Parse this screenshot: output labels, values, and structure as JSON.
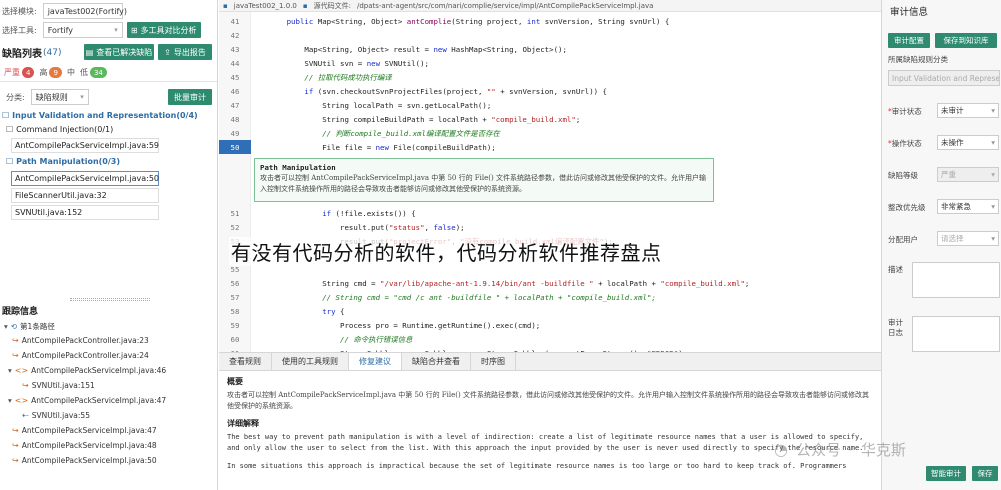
{
  "left": {
    "module_label": "选择模块:",
    "module_value": "javaTest002(Fortify)",
    "tool_label": "选择工具:",
    "tool_value": "Fortify",
    "compare_btn": "多工具对比分析",
    "defects_title": "缺陷列表",
    "defects_count": "(47)",
    "resolved_btn": "查看已解决缺陷",
    "export_btn": "导出报告",
    "sev_critical": "严重",
    "sev_critical_n": "4",
    "sev_high": "高",
    "sev_high_n": "9",
    "sev_mid": "中",
    "sev_low": "低",
    "sev_low_n": "34",
    "classify_label": "分类:",
    "classify_value": "缺陷规则",
    "batch_btn": "批量审计",
    "group1_title": "Input Validation and Representation(0/4)",
    "group1_sub": "Command Injection(0/1)",
    "group1_file": "AntCompilePackServiceImpl.java:59",
    "group2_sub": "Path Manipulation(0/3)",
    "group2_files": [
      "AntCompilePackServiceImpl.java:50",
      "FileScannerUtil.java:32",
      "SVNUtil.java:152"
    ],
    "trace_title": "跟踪信息",
    "trace_root": "第1条路径",
    "trace_items": [
      "AntCompilePackController.java:23",
      "AntCompilePackController.java:24",
      "AntCompilePackServiceImpl.java:46",
      "SVNUtil.java:151",
      "AntCompilePackServiceImpl.java:47",
      "SVNUtil.java:55",
      "AntCompilePackServiceImpl.java:47",
      "AntCompilePackServiceImpl.java:48",
      "AntCompilePackServiceImpl.java:50"
    ]
  },
  "topbar": {
    "project": "javaTest002_1.0.0",
    "path_label": "源代码文件:",
    "path": "/dpats-ant-agent/src/com/nari/complie/service/impl/AntCompilePackServiceImpl.java"
  },
  "code": {
    "lines": [
      {
        "n": "41",
        "t": "        public Map<String, Object> antComplie(String project, int svnVersion, String svnUrl) {"
      },
      {
        "n": "42",
        "t": ""
      },
      {
        "n": "43",
        "t": "            Map<String, Object> result = new HashMap<String, Object>();"
      },
      {
        "n": "44",
        "t": "            SVNUtil svn = new SVNUtil();"
      },
      {
        "n": "45",
        "t": "            // 拉取代码成功执行编译"
      },
      {
        "n": "46",
        "t": "            if (svn.checkoutSvnProjectFiles(project, \"\" + svnVersion, svnUrl)) {"
      },
      {
        "n": "47",
        "t": "                String localPath = svn.getLocalPath();"
      },
      {
        "n": "48",
        "t": "                String compileBuildPath = localPath + \"compile_build.xml\";"
      },
      {
        "n": "49",
        "t": "                // 判断compile_build.xml编译配置文件是否存在"
      },
      {
        "n": "50",
        "t": "                File file = new File(compileBuildPath);"
      },
      {
        "n": "51",
        "t": "                if (!file.exists()) {"
      },
      {
        "n": "52",
        "t": "                    result.put(\"status\", false);"
      },
      {
        "n": "53",
        "t": "                    result.put(\"projectError\", \"没有compile_build.xml编译配置文件\");"
      },
      {
        "n": "54",
        "t": ""
      },
      {
        "n": "55",
        "t": ""
      },
      {
        "n": "56",
        "t": "                String cmd = \"/var/lib/apache-ant-1.9.14/bin/ant -buildfile \" + localPath + \"compile_build.xml\";"
      },
      {
        "n": "57",
        "t": "                // String cmd = \"cmd /c ant -buildfile \" + localPath + \"compile_build.xml\";"
      },
      {
        "n": "58",
        "t": "                try {"
      },
      {
        "n": "59",
        "t": "                    Process pro = Runtime.getRuntime().exec(cmd);"
      },
      {
        "n": "60",
        "t": "                    // 命令执行错误信息"
      },
      {
        "n": "61",
        "t": "                    StreamGobbler errorGobbler = new StreamGobbler(pro.getErrorStream(), \"ERROR\");"
      }
    ],
    "highlight_line": "50",
    "popup_title": "Path Manipulation",
    "popup_text": "攻击者可以控制 AntCompilePackServiceImpl.java 中第 50 行的 File() 文件系统路径参数，借此访问或修改其他受保护的文件。允许用户输入控制文件系统操作所用的路径会导致攻击者能够访问或修改其他受保护的系统资源。"
  },
  "tabs": [
    "查看规则",
    "使用的工具规则",
    "修复建议",
    "缺陷合并查看",
    "时序图"
  ],
  "active_tab": "修复建议",
  "detail": {
    "summary_h": "概要",
    "summary_t": "攻击者可以控制 AntCompilePackServiceImpl.java 中第 50 行的 File() 文件系统路径参数，借此访问或修改其他受保护的文件。允许用户输入控制文件系统操作所用的路径会导致攻击者能够访问或修改其他受保护的系统资源。",
    "explain_h": "详细解释",
    "explain_t": "The best way to prevent path manipulation is with a level of indirection: create a list of legitimate resource names that a user is allowed to specify, and only allow the user to select from the list. With this approach the input provided by the user is never used directly to specify the resource name.",
    "explain_t2": "In some situations this approach is impractical because the set of legitimate resource names is too large or too hard to keep track of. Programmers"
  },
  "right": {
    "title": "审计信息",
    "btn_config": "审计配置",
    "btn_save_kb": "保存到知识库",
    "rule_class_label": "所属缺陷规则分类",
    "rule_class_value": "Input Validation and Represe",
    "audit_status_label": "审计状态",
    "audit_status_value": "未审计",
    "op_status_label": "操作状态",
    "op_status_value": "未操作",
    "level_label": "缺陷等级",
    "level_value": "严重",
    "priority_label": "整改优先级",
    "priority_value": "非常紧急",
    "assign_label": "分配用户",
    "assign_value": "请选择",
    "desc_label": "描述",
    "log_label": "审计日志",
    "btn_smart": "智能审计",
    "btn_save": "保存"
  },
  "overlay": {
    "headline": "有没有代码分析的软件，代码分析软件推荐盘点",
    "watermark_a": "公众号",
    "watermark_b": "华克斯"
  },
  "colors": {
    "accent_green": "#2e8b6f",
    "accent_blue": "#2f6fb8",
    "critical": "#d9534f",
    "high": "#e8793a",
    "low": "#5cb85c"
  }
}
